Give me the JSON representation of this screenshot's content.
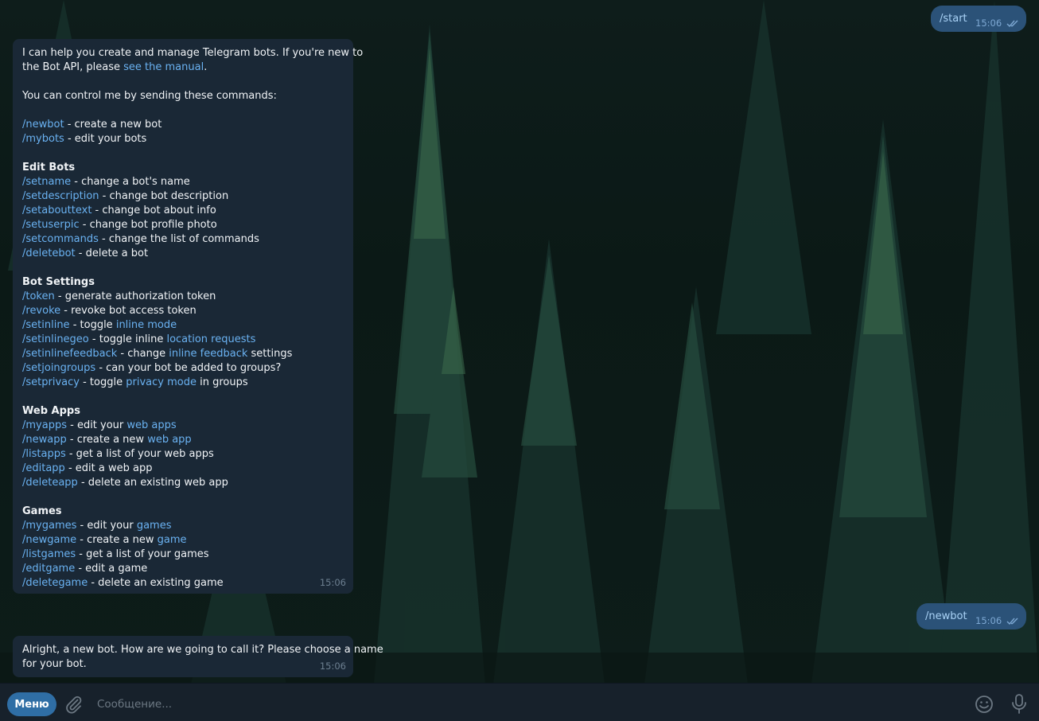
{
  "outgoing": [
    {
      "text": "/start",
      "time": "15:06"
    },
    {
      "text": "/newbot",
      "time": "15:06"
    }
  ],
  "bot_help": {
    "time": "15:06",
    "lines": [
      [
        {
          "t": "I can help you create and manage Telegram bots. If you're new to"
        }
      ],
      [
        {
          "t": "the Bot API, please "
        },
        {
          "t": "see the manual",
          "k": "lnk"
        },
        {
          "t": "."
        }
      ],
      [],
      [
        {
          "t": "You can control me by sending these commands:"
        }
      ],
      [],
      [
        {
          "t": "/newbot",
          "k": "cmd"
        },
        {
          "t": " - create a new bot"
        }
      ],
      [
        {
          "t": "/mybots",
          "k": "cmd"
        },
        {
          "t": " - edit your bots"
        }
      ],
      [],
      [
        {
          "t": "Edit Bots",
          "k": "bold"
        }
      ],
      [
        {
          "t": "/setname",
          "k": "cmd"
        },
        {
          "t": " - change a bot's name"
        }
      ],
      [
        {
          "t": "/setdescription",
          "k": "cmd"
        },
        {
          "t": " - change bot description"
        }
      ],
      [
        {
          "t": "/setabouttext",
          "k": "cmd"
        },
        {
          "t": " - change bot about info"
        }
      ],
      [
        {
          "t": "/setuserpic",
          "k": "cmd"
        },
        {
          "t": " - change bot profile photo"
        }
      ],
      [
        {
          "t": "/setcommands",
          "k": "cmd"
        },
        {
          "t": " - change the list of commands"
        }
      ],
      [
        {
          "t": "/deletebot",
          "k": "cmd"
        },
        {
          "t": " - delete a bot"
        }
      ],
      [],
      [
        {
          "t": "Bot Settings",
          "k": "bold"
        }
      ],
      [
        {
          "t": "/token",
          "k": "cmd"
        },
        {
          "t": " - generate authorization token"
        }
      ],
      [
        {
          "t": "/revoke",
          "k": "cmd"
        },
        {
          "t": " - revoke bot access token"
        }
      ],
      [
        {
          "t": "/setinline",
          "k": "cmd"
        },
        {
          "t": " - toggle "
        },
        {
          "t": "inline mode",
          "k": "lnk"
        }
      ],
      [
        {
          "t": "/setinlinegeo",
          "k": "cmd"
        },
        {
          "t": " - toggle inline "
        },
        {
          "t": "location requests",
          "k": "lnk"
        }
      ],
      [
        {
          "t": "/setinlinefeedback",
          "k": "cmd"
        },
        {
          "t": " - change "
        },
        {
          "t": "inline feedback",
          "k": "lnk"
        },
        {
          "t": " settings"
        }
      ],
      [
        {
          "t": "/setjoingroups",
          "k": "cmd"
        },
        {
          "t": " - can your bot be added to groups?"
        }
      ],
      [
        {
          "t": "/setprivacy",
          "k": "cmd"
        },
        {
          "t": " - toggle "
        },
        {
          "t": "privacy mode",
          "k": "lnk"
        },
        {
          "t": " in groups"
        }
      ],
      [],
      [
        {
          "t": "Web Apps",
          "k": "bold"
        }
      ],
      [
        {
          "t": "/myapps",
          "k": "cmd"
        },
        {
          "t": " - edit your "
        },
        {
          "t": "web apps",
          "k": "lnk"
        }
      ],
      [
        {
          "t": "/newapp",
          "k": "cmd"
        },
        {
          "t": " - create a new "
        },
        {
          "t": "web app",
          "k": "lnk"
        }
      ],
      [
        {
          "t": "/listapps",
          "k": "cmd"
        },
        {
          "t": " - get a list of your web apps"
        }
      ],
      [
        {
          "t": "/editapp",
          "k": "cmd"
        },
        {
          "t": " - edit a web app"
        }
      ],
      [
        {
          "t": "/deleteapp",
          "k": "cmd"
        },
        {
          "t": " - delete an existing web app"
        }
      ],
      [],
      [
        {
          "t": "Games",
          "k": "bold"
        }
      ],
      [
        {
          "t": "/mygames",
          "k": "cmd"
        },
        {
          "t": " - edit your "
        },
        {
          "t": "games",
          "k": "lnk"
        }
      ],
      [
        {
          "t": "/newgame",
          "k": "cmd"
        },
        {
          "t": " - create a new "
        },
        {
          "t": "game",
          "k": "lnk"
        }
      ],
      [
        {
          "t": "/listgames",
          "k": "cmd"
        },
        {
          "t": " - get a list of your games"
        }
      ],
      [
        {
          "t": "/editgame",
          "k": "cmd"
        },
        {
          "t": " - edit a game"
        }
      ],
      [
        {
          "t": "/deletegame",
          "k": "cmd"
        },
        {
          "t": " - delete an existing game"
        }
      ]
    ]
  },
  "bot_reply": {
    "line1": "Alright, a new bot. How are we going to call it? Please choose a name",
    "line2": "for your bot.",
    "time": "15:06"
  },
  "input_bar": {
    "menu_label": "Меню",
    "placeholder": "Сообщение...",
    "value": "",
    "icons": [
      "paperclip-icon",
      "smile-icon",
      "microphone-icon"
    ]
  },
  "colors": {
    "accent": "#2f6ea5",
    "link": "#6ab2f2",
    "incoming_bubble": "#1a2836",
    "outgoing_bubble": "#2b5278",
    "input_bar": "#17212b"
  }
}
